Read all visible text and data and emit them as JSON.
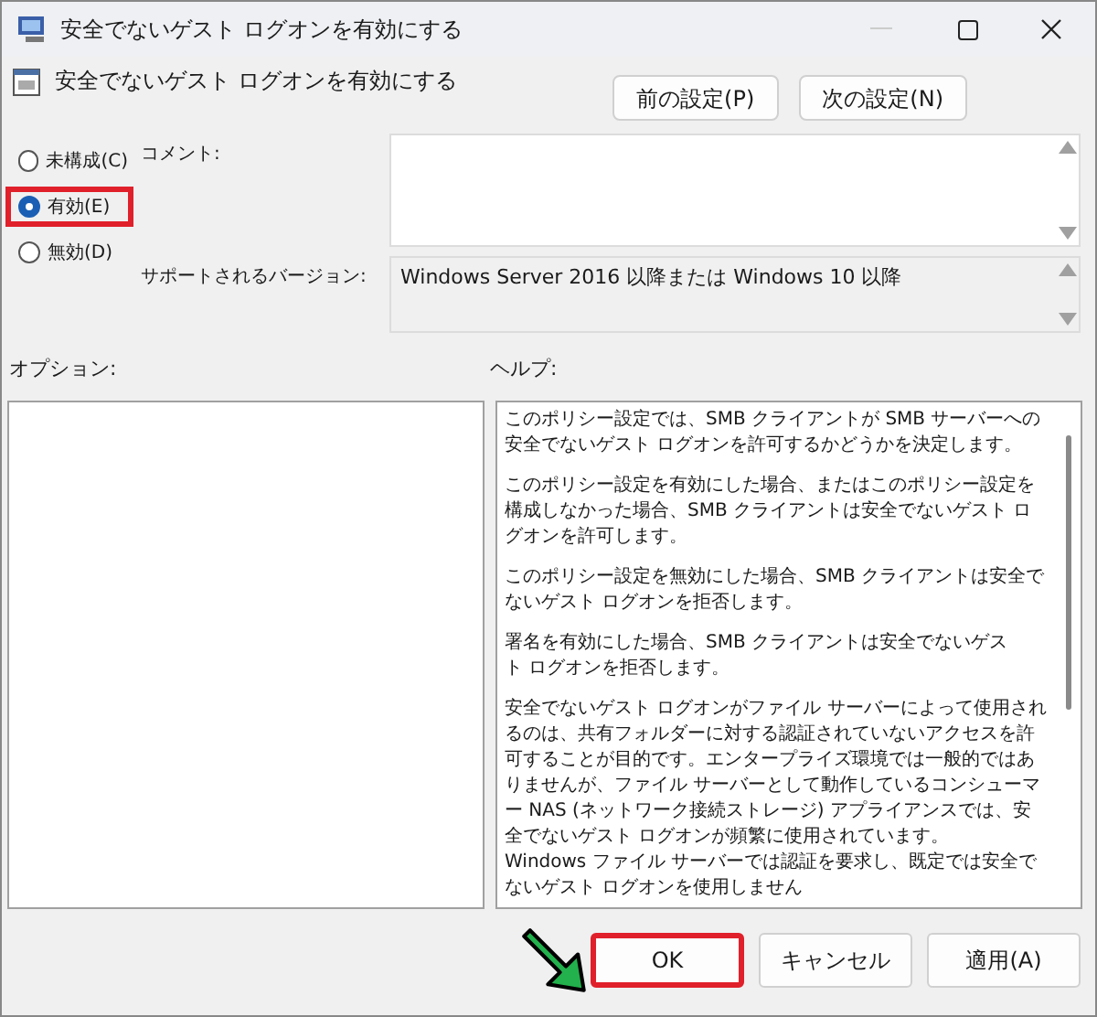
{
  "window": {
    "title": "安全でないゲスト ログオンを有効にする"
  },
  "policy": {
    "title": "安全でないゲスト ログオンを有効にする"
  },
  "nav_buttons": [
    "前の設定(P)",
    "次の設定(N)"
  ],
  "options": [
    {
      "label": "未構成(C)",
      "selected": false,
      "highlighted": false
    },
    {
      "label": "有効(E)",
      "selected": true,
      "highlighted": true
    },
    {
      "label": "無効(D)",
      "selected": false,
      "highlighted": false
    }
  ],
  "comment": {
    "label": "コメント:"
  },
  "supported": {
    "label": "サポートされるバージョン:",
    "value": "Windows Server 2016 以降または Windows 10 以降"
  },
  "options_panel": {
    "label": "オプション:"
  },
  "help": {
    "label": "ヘルプ:",
    "paragraphs": [
      "このポリシー設定では、SMB クライアントが SMB サーバーへの安全でないゲスト ログオンを許可するかどうかを決定します。",
      "このポリシー設定を有効にした場合、またはこのポリシー設定を構成しなかった場合、SMB クライアントは安全でないゲスト ログオンを許可します。",
      "このポリシー設定を無効にした場合、SMB クライアントは安全でないゲスト ログオンを拒否します。",
      "署名を有効にした場合、SMB クライアントは安全でないゲスト ログオンを拒否します。",
      "安全でないゲスト ログオンがファイル サーバーによって使用されるのは、共有フォルダーに対する認証されていないアクセスを許可することが目的です。エンタープライズ環境では一般的ではありませんが、ファイル サーバーとして動作しているコンシューマー NAS (ネットワーク接続ストレージ) アプライアンスでは、安全でないゲスト ログオンが頻繁に使用されています。Windows ファイル サーバーでは認証を要求し、既定では安全でないゲスト ログオンを使用しません"
    ]
  },
  "buttons": [
    {
      "label": "OK",
      "highlighted": true
    },
    {
      "label": "キャンセル",
      "highlighted": false
    },
    {
      "label": "適用(A)",
      "highlighted": false
    }
  ]
}
